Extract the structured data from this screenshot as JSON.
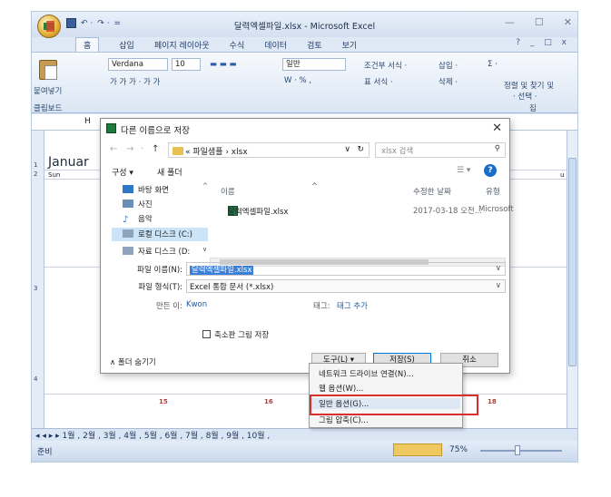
{
  "app": {
    "title": "달력엑셀파일.xlsx - Microsoft Excel",
    "window_controls": [
      "—",
      "☐",
      "✕"
    ],
    "qat": [
      "↶ ·",
      "↷ ·",
      "="
    ]
  },
  "ribbon": {
    "tabs": [
      "홈",
      "삽입",
      "페이지 레이아웃",
      "수식",
      "데이터",
      "검토",
      "보기"
    ],
    "right_controls": "? _ □ x",
    "paste_label": "붙여넣기",
    "clipboard_label": "클립보드",
    "font_name": "Verdana",
    "font_size": "10",
    "font_styles": "가 가 가 · 가 가",
    "number_format": "일반",
    "number_tools": "W · % ,",
    "conditional_format": "조건부 서식 ·",
    "table_format": "표 서식 ·",
    "insert": "삽입 ·",
    "delete": "삭제 ·",
    "sigma": "Σ ·",
    "sort_filter": "정렬 및 찾기 및",
    "select": "· 선택 ·",
    "edit_group": "집"
  },
  "sheet": {
    "name_box": "H",
    "month_label": "Januar",
    "day_sun": "Sun",
    "day_right": "u",
    "row_numbers": [
      "1",
      "2",
      "3",
      "4"
    ],
    "cells": [
      "15",
      "16",
      "18"
    ],
    "tabs_text": "◂ ◂ ▸ ▸  1월 , 2월 , 3월 , 4월 , 5월 , 6월 , 7월 , 8월 , 9월 , 10월 ,",
    "status_ready": "준비",
    "zoom": "75%"
  },
  "dialog": {
    "title": "다른 이름으로 저장",
    "close": "✕",
    "nav_buttons": [
      "←",
      "→",
      "·",
      "↑"
    ],
    "address_path": "« 파일샘플 › xlsx",
    "refresh": "↻",
    "search_placeholder": "xlsx 검색",
    "organize": "구성 ▾",
    "new_folder": "새 폴더",
    "view_icon": "☰ ▾",
    "help": "?",
    "nav_items": [
      "바탕 화면",
      "사진",
      "음악",
      "로컬 디스크 (C:)",
      "자료 디스크 (D:"
    ],
    "columns": {
      "name": "이름",
      "modified": "수정한 날짜",
      "type": "유형"
    },
    "file": {
      "name": "달력엑셀파일.xlsx",
      "modified": "2017-03-18 오전...",
      "type": "Microsoft"
    },
    "filename_label": "파일 이름(N):",
    "filename_value": "달력엑셀파일.xlsx",
    "filetype_label": "파일 형식(T):",
    "filetype_value": "Excel 통합 문서 (*.xlsx)",
    "author_label": "만든 이:",
    "author_value": "Kwon",
    "tags_label": "태그:",
    "tags_value": "태그 추가",
    "save_thumbnail": "축소판 그림 저장",
    "hide_folders": "∧ 폴더 숨기기",
    "tools_button": "도구(L)  ▾",
    "save_button": "저장(S)",
    "cancel_button": "취소"
  },
  "tools_menu": {
    "items": [
      "네트워크 드라이브 연결(N)...",
      "웹 옵션(W)...",
      "일반 옵션(G)...",
      "그림 압축(C)..."
    ],
    "highlighted_index": 2
  },
  "colors": {
    "highlight_box": "#d9302e",
    "selection": "#3a7fd9"
  }
}
